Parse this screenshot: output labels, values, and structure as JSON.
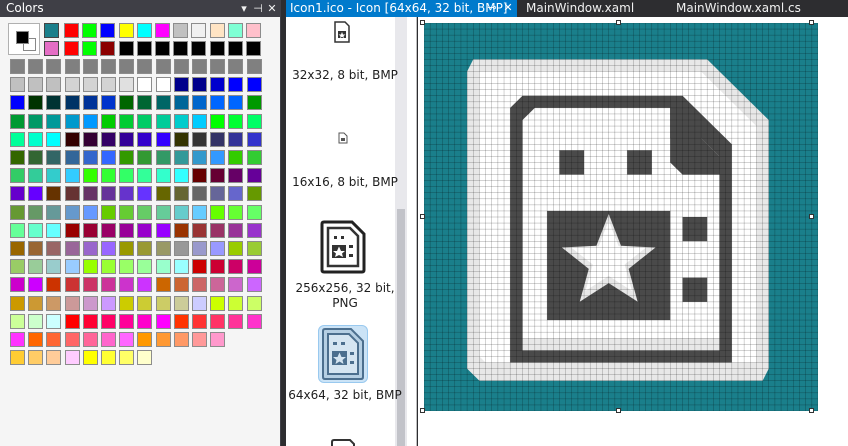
{
  "colors_panel": {
    "title": "Colors",
    "pin_icon": "pin-icon",
    "close_icon": "close-icon",
    "dropdown_icon": "chevron-down-icon",
    "foreground": "#000000",
    "background": "#ffffff"
  },
  "tabs": {
    "active": {
      "label": "Icon1.ico - Icon [64x64, 32 bit, BMP]",
      "pin_icon": "pin-icon",
      "close_icon": "close-icon"
    },
    "others": [
      {
        "label": "MainWindow.xaml"
      },
      {
        "label": "MainWindow.xaml.cs"
      }
    ]
  },
  "image_list": {
    "entries": [
      {
        "label": "32x32, 8 bit, BMP"
      },
      {
        "label": "16x16, 8 bit, BMP"
      },
      {
        "label": "256x256, 32 bit, PNG"
      },
      {
        "label": "64x64, 32 bit, BMP",
        "selected": true
      }
    ]
  },
  "canvas": {
    "image_size": "64x64",
    "teal": "#1a7f8b",
    "white": "#ffffff",
    "dark": "#4a4a4a",
    "gray": "#a0a0a0",
    "lightgray": "#e8e8e8"
  }
}
